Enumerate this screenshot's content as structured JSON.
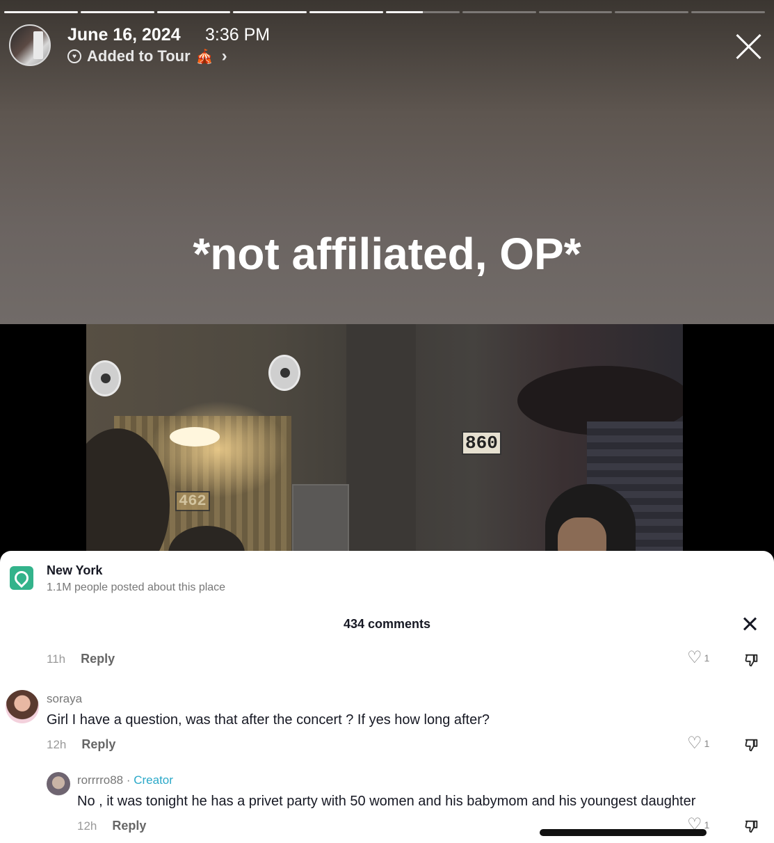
{
  "story": {
    "progress": [
      1,
      1,
      1,
      1,
      1,
      0.5,
      0,
      0,
      0,
      0
    ],
    "date": "June 16, 2024",
    "time": "3:36 PM",
    "added_to": "Added to Tour",
    "added_icon": "circus-tent-emoji",
    "overlay_text": "*not affiliated, OP*"
  },
  "video": {
    "sign_860": "860",
    "sign_462": "462"
  },
  "panel": {
    "place": {
      "name": "New York",
      "subtitle": "1.1M people posted about this place"
    },
    "comments_count": "434 comments",
    "comments": [
      {
        "time": "11h",
        "reply_label": "Reply",
        "likes": "1"
      },
      {
        "username": "soraya",
        "text": "Girl I have a question, was that after the concert ? If yes how long after?",
        "time": "12h",
        "reply_label": "Reply",
        "likes": "1"
      },
      {
        "username": "rorrrro88",
        "separator": " · ",
        "creator_label": "Creator",
        "text": "No , it was tonight he has a privet party with 50 women and his babymom and his youngest daughter",
        "time": "12h",
        "reply_label": "Reply",
        "likes": "1"
      }
    ]
  }
}
